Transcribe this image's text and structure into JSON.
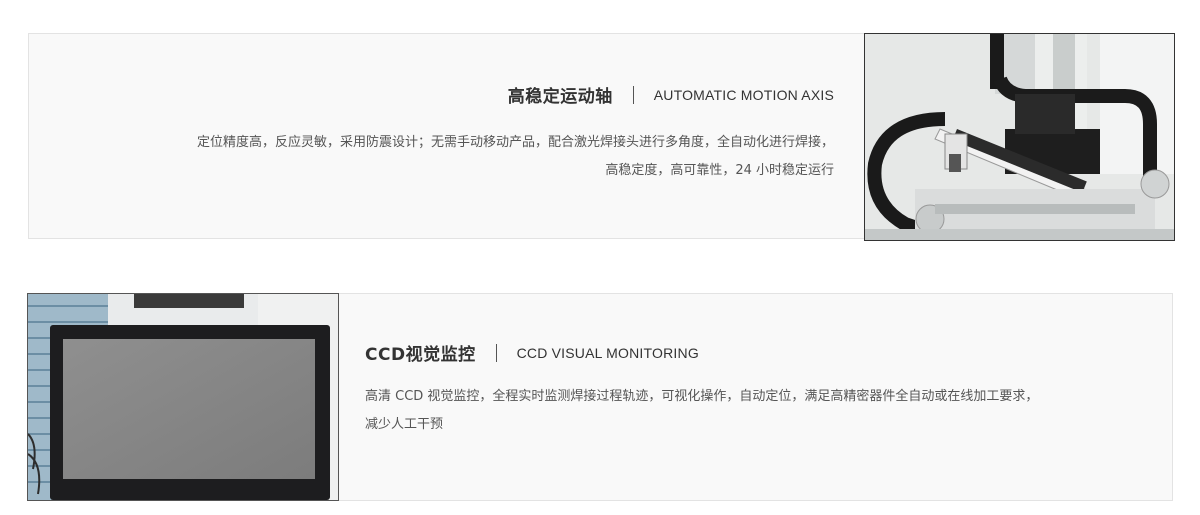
{
  "features": [
    {
      "title_cn": "高稳定运动轴",
      "title_en": "AUTOMATIC MOTION AXIS",
      "description_line1": "定位精度高，反应灵敏，采用防震设计；无需手动移动产品，配合激光焊接头进行多角度，全自动化进行焊接，",
      "description_line2": "高稳定度，高可靠性，24 小时稳定运行",
      "image": "motion-axis-machine-photo"
    },
    {
      "title_cn": "CCD视觉监控",
      "title_en": "CCD VISUAL MONITORING",
      "description_line1": "高清 CCD 视觉监控，全程实时监测焊接过程轨迹，可视化操作，自动定位，满足高精密器件全自动或在线加工要求，",
      "description_line2": "减少人工干预",
      "image": "ccd-monitor-screen-photo"
    }
  ],
  "colors": {
    "panel_bg": "#f9f9f9",
    "panel_border": "#e3e3e3",
    "title_text": "#333333",
    "body_text": "#555555"
  }
}
